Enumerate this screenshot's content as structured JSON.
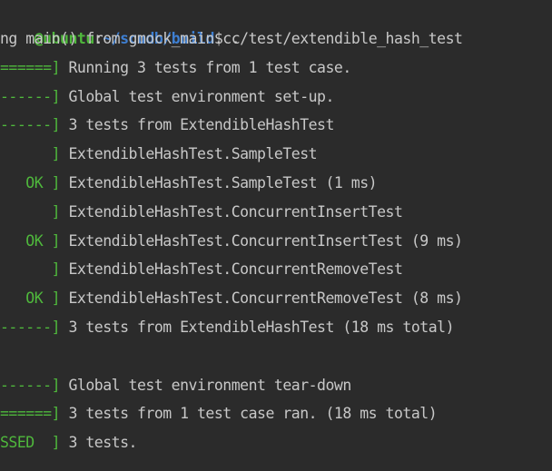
{
  "prompt": {
    "user_host": "@ubuntu",
    "colon": ":",
    "path": "~/scudb/build",
    "symbol": "$",
    "command": " ./test/extendible_hash_test"
  },
  "lines": [
    {
      "prefix": "ng",
      "text": " main() from gmock_main.cc",
      "prefix_color": "plain"
    },
    {
      "prefix": "======]",
      "text": " Running 3 tests from 1 test case.",
      "prefix_color": "green"
    },
    {
      "prefix": "------]",
      "text": " Global test environment set-up.",
      "prefix_color": "green"
    },
    {
      "prefix": "------]",
      "text": " 3 tests from ExtendibleHashTest",
      "prefix_color": "green"
    },
    {
      "prefix": "      ]",
      "text": " ExtendibleHashTest.SampleTest",
      "prefix_color": "green"
    },
    {
      "prefix": "   OK ]",
      "text": " ExtendibleHashTest.SampleTest (1 ms)",
      "prefix_color": "green"
    },
    {
      "prefix": "      ]",
      "text": " ExtendibleHashTest.ConcurrentInsertTest",
      "prefix_color": "green"
    },
    {
      "prefix": "   OK ]",
      "text": " ExtendibleHashTest.ConcurrentInsertTest (9 ms)",
      "prefix_color": "green"
    },
    {
      "prefix": "      ]",
      "text": " ExtendibleHashTest.ConcurrentRemoveTest",
      "prefix_color": "green"
    },
    {
      "prefix": "   OK ]",
      "text": " ExtendibleHashTest.ConcurrentRemoveTest (8 ms)",
      "prefix_color": "green"
    },
    {
      "prefix": "------]",
      "text": " 3 tests from ExtendibleHashTest (18 ms total)",
      "prefix_color": "green"
    },
    {
      "prefix": "",
      "text": "",
      "prefix_color": "plain"
    },
    {
      "prefix": "------]",
      "text": " Global test environment tear-down",
      "prefix_color": "green"
    },
    {
      "prefix": "======]",
      "text": " 3 tests from 1 test case ran. (18 ms total)",
      "prefix_color": "green"
    },
    {
      "prefix": "SSED  ]",
      "text": " 3 tests.",
      "prefix_color": "green"
    }
  ],
  "colors": {
    "background": "#2b2b2b",
    "text": "#c8c8c8",
    "green": "#4fb83c",
    "blue": "#3e7fd2"
  }
}
